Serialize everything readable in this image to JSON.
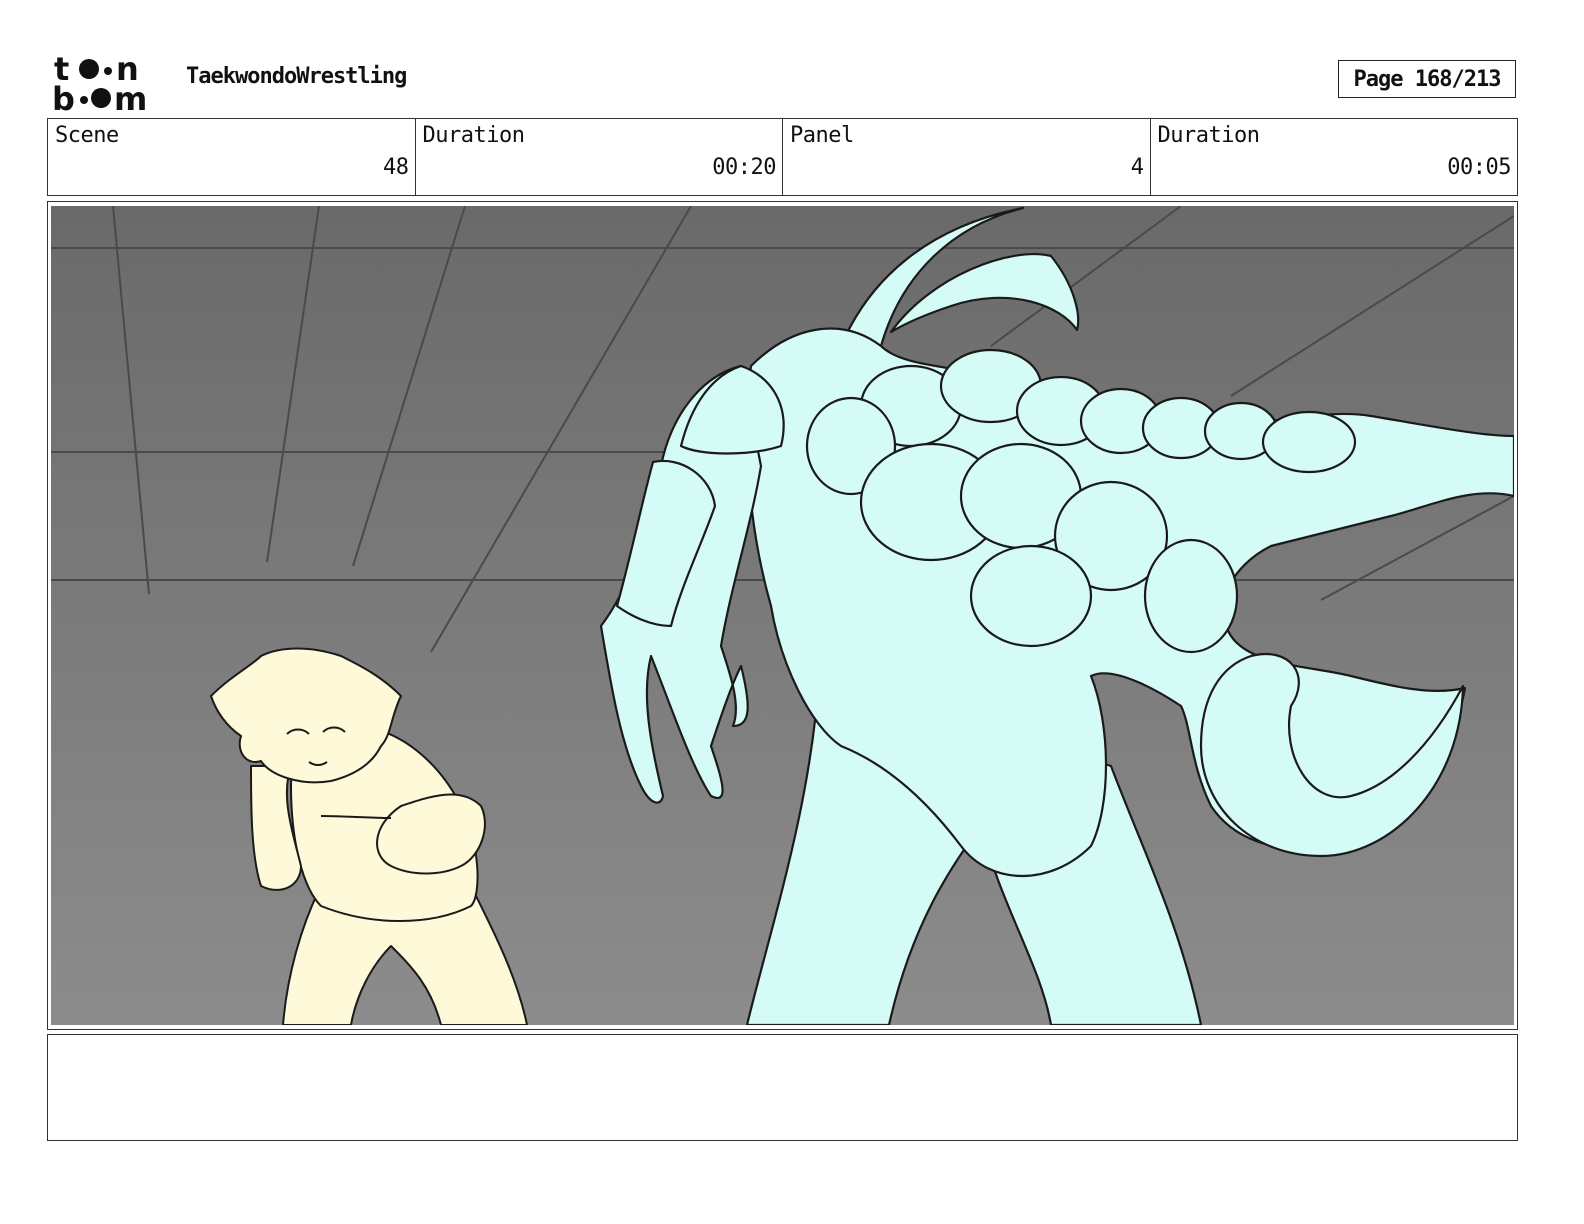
{
  "header": {
    "logo_text": "toon boom",
    "project_title": "TaekwondoWrestling",
    "page_label": "Page 168/213"
  },
  "info": {
    "scene_label": "Scene",
    "scene_value": "48",
    "scene_duration_label": "Duration",
    "scene_duration_value": "00:20",
    "panel_label": "Panel",
    "panel_value": "4",
    "panel_duration_label": "Duration",
    "panel_duration_value": "00:05"
  },
  "colors": {
    "background_top": "#6a6a6a",
    "background_bottom": "#8c8c8c",
    "monster_fill": "#d5fbf7",
    "girl_fill": "#fdf9d9",
    "line": "#1a1a1a"
  },
  "notes": {
    "text": ""
  }
}
